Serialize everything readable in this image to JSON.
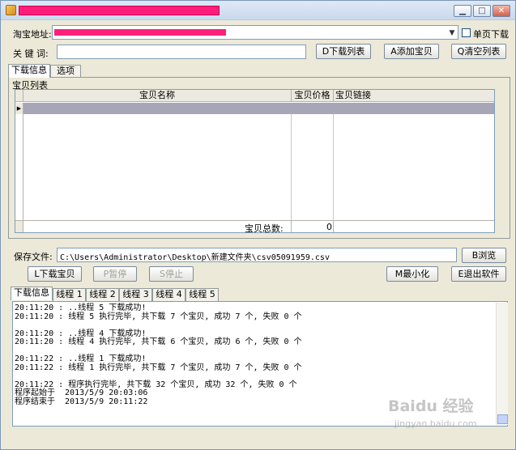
{
  "titlebar": {
    "minimize_glyph": "▁",
    "maximize_glyph": "□",
    "close_glyph": "✕"
  },
  "top": {
    "url_label": "淘宝地址:",
    "single_page_label": "单页下载",
    "keyword_label": "关 键 词:",
    "keyword_value": "",
    "dropdown_glyph": "▼",
    "buttons": {
      "download_list": "D下载列表",
      "add_item": "A添加宝贝",
      "clear_list": "Q清空列表"
    }
  },
  "top_tabs": [
    "下载信息",
    "选项"
  ],
  "item_list": {
    "group_label": "宝贝列表",
    "columns": [
      "宝贝名称",
      "宝贝价格",
      "宝贝链接"
    ],
    "row_indicator": "▶",
    "total_label": "宝贝总数:",
    "total_value": "0"
  },
  "save": {
    "label": "保存文件:",
    "path": "C:\\Users\\Administrator\\Desktop\\新建文件夹\\csv05091959.csv",
    "browse": "B浏览"
  },
  "actions": {
    "download": "L下载宝贝",
    "pause": "P暂停",
    "stop": "S停止",
    "minimize": "M最小化",
    "exit": "E退出软件"
  },
  "log_tabs": [
    "下载信息",
    "线程 1",
    "线程 2",
    "线程 3",
    "线程 4",
    "线程 5"
  ],
  "log_lines": [
    "20:11:20 : ..线程 5 下载成功!",
    "20:11:20 : 线程 5 执行完毕, 共下载 7 个宝贝, 成功 7 个, 失败 0 个",
    "",
    "20:11:20 : ..线程 4 下载成功!",
    "20:11:20 : 线程 4 执行完毕, 共下载 6 个宝贝, 成功 6 个, 失败 0 个",
    "",
    "20:11:22 : ..线程 1 下载成功!",
    "20:11:22 : 线程 1 执行完毕, 共下载 7 个宝贝, 成功 7 个, 失败 0 个",
    "",
    "20:11:22 : 程序执行完毕, 共下载 32 个宝贝, 成功 32 个, 失败 0 个",
    "程序起始于  2013/5/9 20:03:06",
    "程序结束于  2013/5/9 20:11:22"
  ],
  "watermark": {
    "main": "Baidu 经验",
    "sub": "jingyan.baidu.com"
  }
}
